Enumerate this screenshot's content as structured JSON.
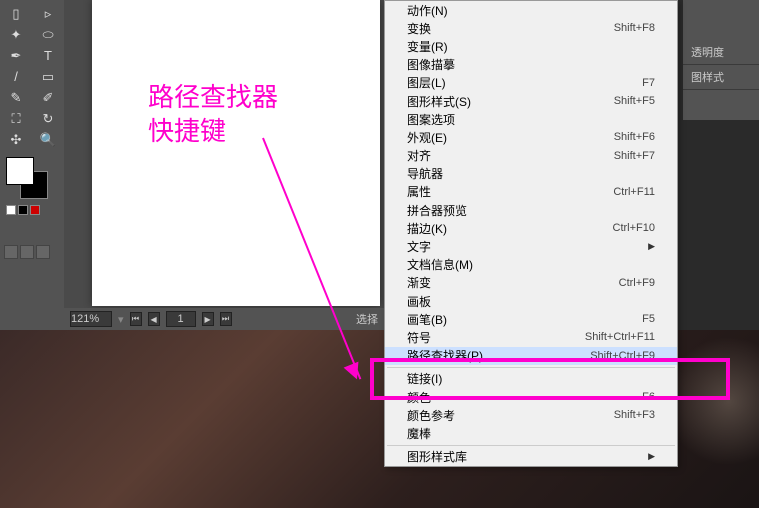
{
  "annotation": {
    "line1": "路径查找器",
    "line2": "快捷键"
  },
  "zoom": "121%",
  "page": "1",
  "status_text": "选择",
  "panels": [
    "透明度",
    "图样式"
  ],
  "tools": [
    "⬚",
    "▭",
    "↘",
    "⬓",
    "T",
    "▦",
    "/",
    "✎",
    "◧",
    "▤",
    "✂",
    "⊕",
    "✋",
    "🔍"
  ],
  "menu": [
    {
      "label": "动作(N)",
      "key": "",
      "sep": false
    },
    {
      "label": "变换",
      "key": "Shift+F8",
      "sep": false
    },
    {
      "label": "变量(R)",
      "key": "",
      "sep": false
    },
    {
      "label": "图像描摹",
      "key": "",
      "sep": false
    },
    {
      "label": "图层(L)",
      "key": "F7",
      "sep": false
    },
    {
      "label": "图形样式(S)",
      "key": "Shift+F5",
      "sep": false
    },
    {
      "label": "图案选项",
      "key": "",
      "sep": false
    },
    {
      "label": "外观(E)",
      "key": "Shift+F6",
      "sep": false
    },
    {
      "label": "对齐",
      "key": "Shift+F7",
      "sep": false
    },
    {
      "label": "导航器",
      "key": "",
      "sep": false
    },
    {
      "label": "属性",
      "key": "Ctrl+F11",
      "sep": false
    },
    {
      "label": "拼合器预览",
      "key": "",
      "sep": false
    },
    {
      "label": "描边(K)",
      "key": "Ctrl+F10",
      "sep": false
    },
    {
      "label": "文字",
      "key": "",
      "arrow": true,
      "sep": false
    },
    {
      "label": "文档信息(M)",
      "key": "",
      "sep": false
    },
    {
      "label": "渐变",
      "key": "Ctrl+F9",
      "sep": false
    },
    {
      "label": "画板",
      "key": "",
      "sep": false
    },
    {
      "label": "画笔(B)",
      "key": "F5",
      "sep": false
    },
    {
      "label": "符号",
      "key": "Shift+Ctrl+F11",
      "sep": false
    },
    {
      "label": "路径查找器(P)",
      "key": "Shift+Ctrl+F9",
      "hl": true,
      "sep": false
    },
    {
      "label": "链接(I)",
      "key": "",
      "sep": true
    },
    {
      "label": "颜色",
      "key": "F6",
      "sep": false
    },
    {
      "label": "颜色参考",
      "key": "Shift+F3",
      "sep": false
    },
    {
      "label": "魔棒",
      "key": "",
      "sep": false
    },
    {
      "label": "图形样式库",
      "key": "",
      "arrow": true,
      "sep": true
    }
  ]
}
